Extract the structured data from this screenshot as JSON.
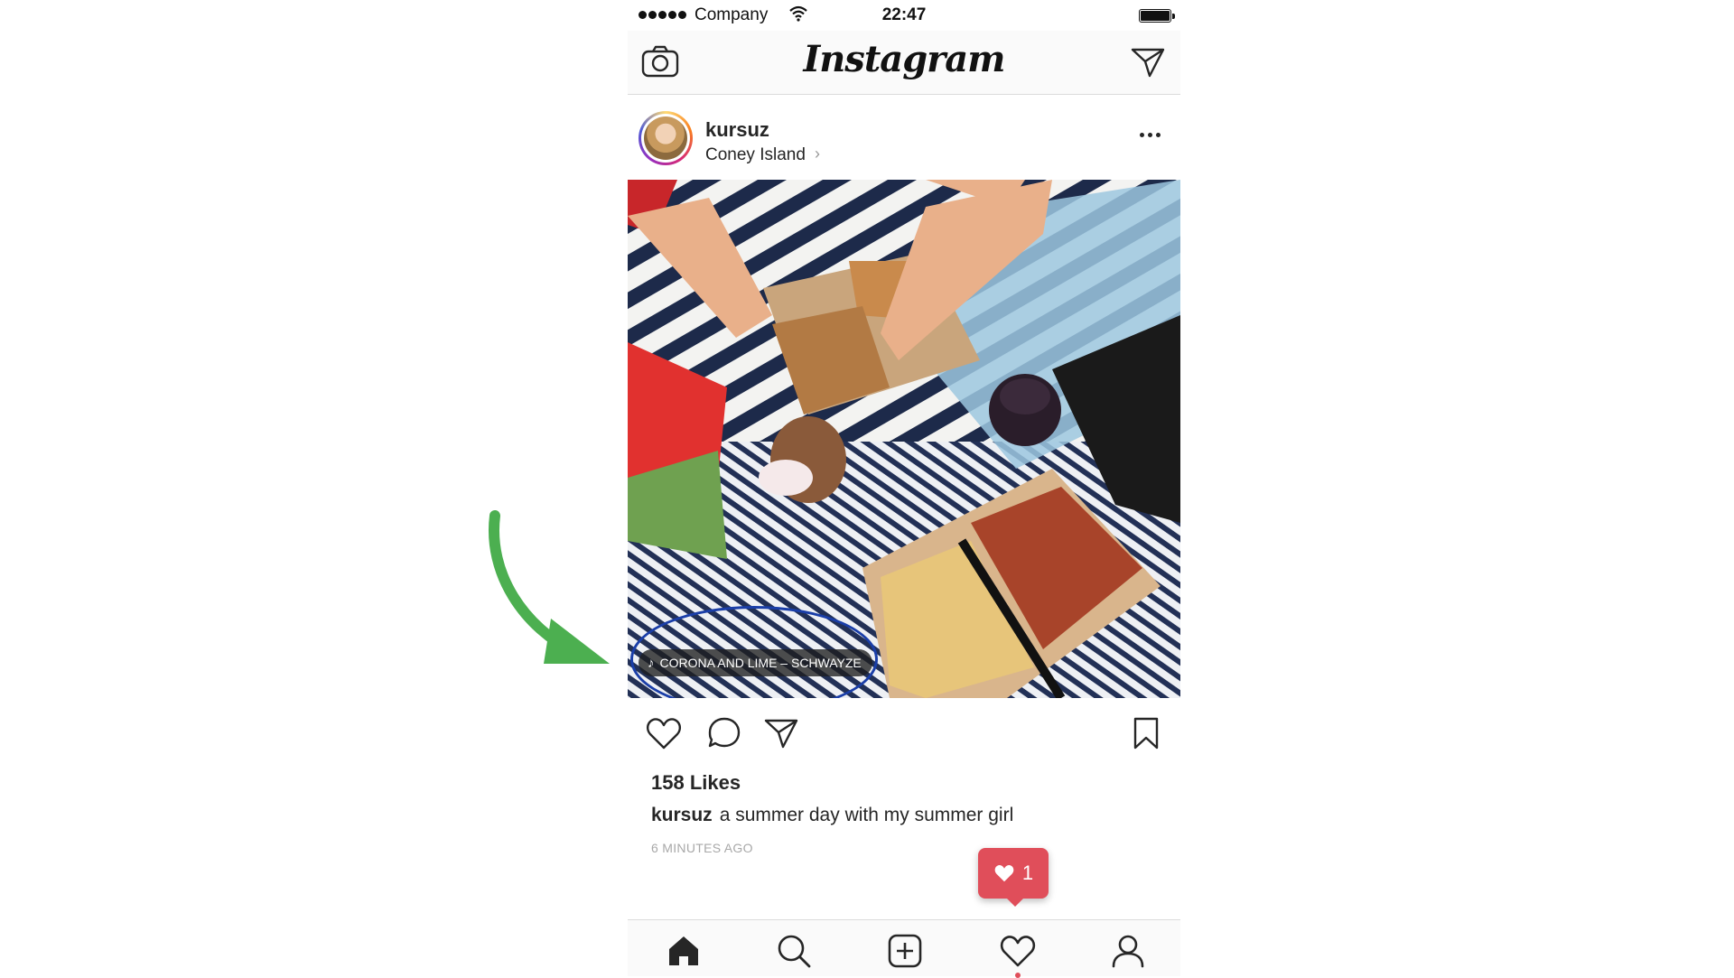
{
  "status_bar": {
    "carrier": "Company",
    "time": "22:47"
  },
  "nav": {
    "logo": "Instagram"
  },
  "post": {
    "username": "kursuz",
    "location": "Coney Island",
    "music": "CORONA AND LIME – SCHWAYZE",
    "likes": "158 Likes",
    "caption_user": "kursuz",
    "caption_text": "a summer day with my summer girl",
    "time_ago": "6 MINUTES AGO"
  },
  "notification": {
    "count": "1"
  },
  "colors": {
    "accent_red": "#e04e5a",
    "annotation_circle": "#1a3ea8",
    "annotation_arrow": "#4caf50"
  },
  "icons": {
    "nav": [
      "camera-icon",
      "direct-message-icon"
    ],
    "post_actions": [
      "heart-icon",
      "comment-icon",
      "share-icon",
      "bookmark-icon"
    ],
    "tabs": [
      "home-icon",
      "search-icon",
      "add-post-icon",
      "activity-heart-icon",
      "profile-icon"
    ]
  }
}
